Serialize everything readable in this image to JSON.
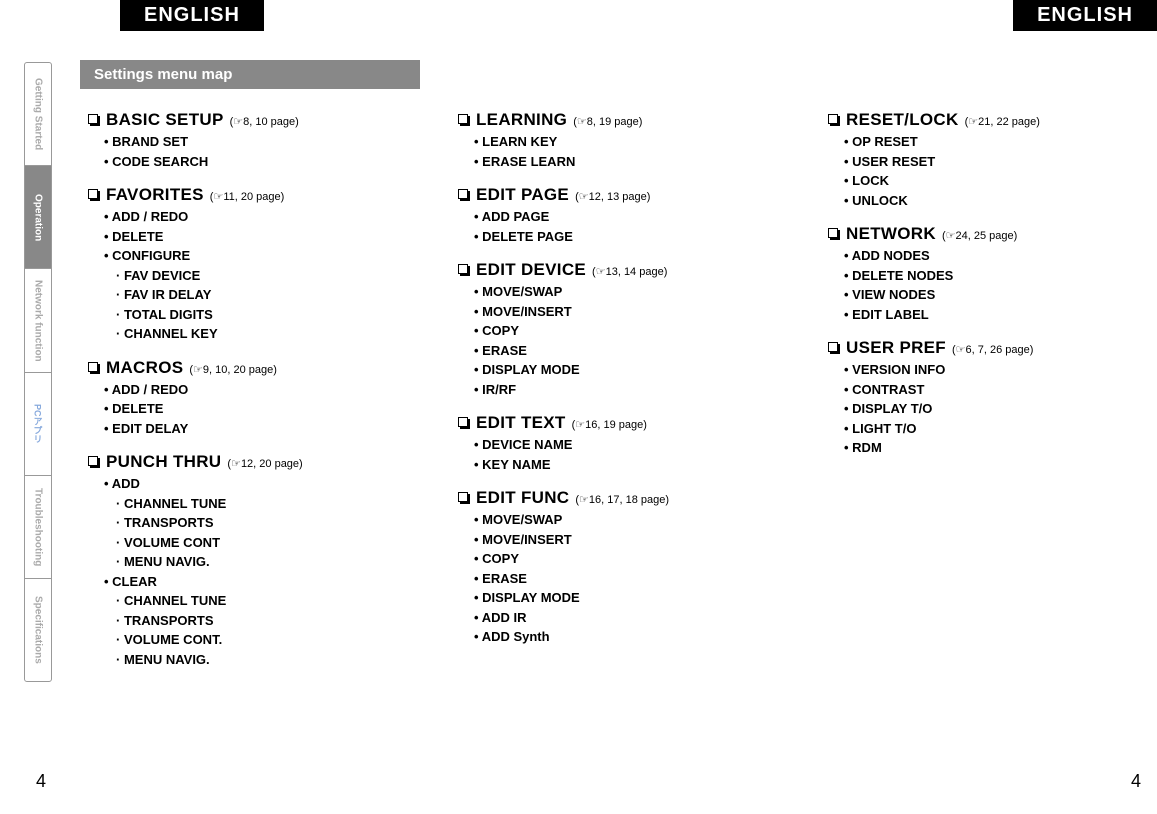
{
  "header": {
    "english": "ENGLISH"
  },
  "sideTabs": [
    {
      "label": "Getting Started",
      "active": false
    },
    {
      "label": "Operation",
      "active": true
    },
    {
      "label": "Network function",
      "active": false
    },
    {
      "label": "PCアプリ",
      "active": false,
      "pc": true
    },
    {
      "label": "Troubleshooting",
      "active": false
    },
    {
      "label": "Specifications",
      "active": false
    }
  ],
  "banner": "Settings menu map",
  "pageNumber": "4",
  "columns": [
    [
      {
        "title": "BASIC SETUP",
        "pages": "8, 10 page",
        "items": [
          {
            "label": "BRAND SET"
          },
          {
            "label": "CODE SEARCH"
          }
        ]
      },
      {
        "title": "FAVORITES",
        "pages": "11, 20 page",
        "items": [
          {
            "label": "ADD / REDO"
          },
          {
            "label": "DELETE"
          },
          {
            "label": "CONFIGURE",
            "sub": [
              "FAV DEVICE",
              "FAV IR DELAY",
              "TOTAL DIGITS",
              "CHANNEL KEY"
            ]
          }
        ]
      },
      {
        "title": "MACROS",
        "pages": "9, 10, 20 page",
        "items": [
          {
            "label": "ADD / REDO"
          },
          {
            "label": "DELETE"
          },
          {
            "label": "EDIT DELAY"
          }
        ]
      },
      {
        "title": "PUNCH THRU",
        "pages": "12, 20 page",
        "items": [
          {
            "label": "ADD",
            "sub": [
              "CHANNEL TUNE",
              "TRANSPORTS",
              "VOLUME CONT",
              "MENU NAVIG."
            ]
          },
          {
            "label": "CLEAR",
            "sub": [
              "CHANNEL TUNE",
              "TRANSPORTS",
              "VOLUME CONT.",
              "MENU NAVIG."
            ]
          }
        ]
      }
    ],
    [
      {
        "title": "LEARNING",
        "pages": "8, 19 page",
        "items": [
          {
            "label": "LEARN KEY"
          },
          {
            "label": "ERASE LEARN"
          }
        ]
      },
      {
        "title": "EDIT PAGE",
        "pages": "12, 13 page",
        "items": [
          {
            "label": "ADD PAGE"
          },
          {
            "label": "DELETE PAGE"
          }
        ]
      },
      {
        "title": "EDIT DEVICE",
        "pages": "13, 14 page",
        "items": [
          {
            "label": "MOVE/SWAP"
          },
          {
            "label": "MOVE/INSERT"
          },
          {
            "label": "COPY"
          },
          {
            "label": "ERASE"
          },
          {
            "label": "DISPLAY MODE"
          },
          {
            "label": "IR/RF"
          }
        ]
      },
      {
        "title": "EDIT TEXT",
        "pages": "16, 19 page",
        "items": [
          {
            "label": "DEVICE NAME"
          },
          {
            "label": "KEY NAME"
          }
        ]
      },
      {
        "title": "EDIT FUNC",
        "pages": "16, 17, 18 page",
        "items": [
          {
            "label": "MOVE/SWAP"
          },
          {
            "label": "MOVE/INSERT"
          },
          {
            "label": "COPY"
          },
          {
            "label": "ERASE"
          },
          {
            "label": "DISPLAY MODE"
          },
          {
            "label": "ADD IR"
          },
          {
            "label": "ADD Synth"
          }
        ]
      }
    ],
    [
      {
        "title": "RESET/LOCK",
        "pages": "21, 22 page",
        "items": [
          {
            "label": "OP RESET"
          },
          {
            "label": "USER RESET"
          },
          {
            "label": "LOCK"
          },
          {
            "label": "UNLOCK"
          }
        ]
      },
      {
        "title": "NETWORK",
        "pages": "24, 25 page",
        "items": [
          {
            "label": "ADD NODES"
          },
          {
            "label": "DELETE NODES"
          },
          {
            "label": "VIEW NODES"
          },
          {
            "label": "EDIT LABEL"
          }
        ]
      },
      {
        "title": "USER PREF",
        "pages": "6, 7, 26 page",
        "items": [
          {
            "label": "VERSION INFO"
          },
          {
            "label": "CONTRAST"
          },
          {
            "label": "DISPLAY T/O"
          },
          {
            "label": "LIGHT T/O"
          },
          {
            "label": "RDM"
          }
        ]
      }
    ]
  ]
}
